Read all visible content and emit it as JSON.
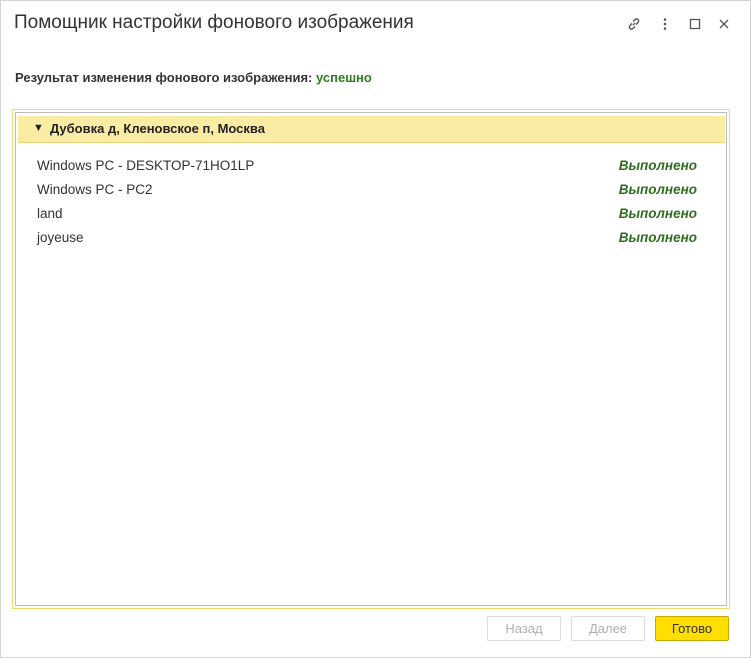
{
  "window": {
    "title": "Помощник настройки фонового изображения"
  },
  "titlebar_icons": [
    "link-icon",
    "more-vertical-icon",
    "maximize-icon",
    "close-icon"
  ],
  "result": {
    "label": "Результат изменения фонового изображения:",
    "status": "успешно",
    "status_color": "#2f7d20"
  },
  "group": {
    "arrow": "▼",
    "title": "Дубовка д, Кленовское п, Москва",
    "header_color": "#fbeca4"
  },
  "rows": [
    {
      "name": "Windows PC - DESKTOP-71HO1LP",
      "status": "Выполнено"
    },
    {
      "name": "Windows PC - PC2",
      "status": "Выполнено"
    },
    {
      "name": "land",
      "status": "Выполнено"
    },
    {
      "name": "joyeuse",
      "status": "Выполнено"
    }
  ],
  "buttons": {
    "back": "Назад",
    "next": "Далее",
    "done": "Готово",
    "done_color": "#ffde00"
  }
}
